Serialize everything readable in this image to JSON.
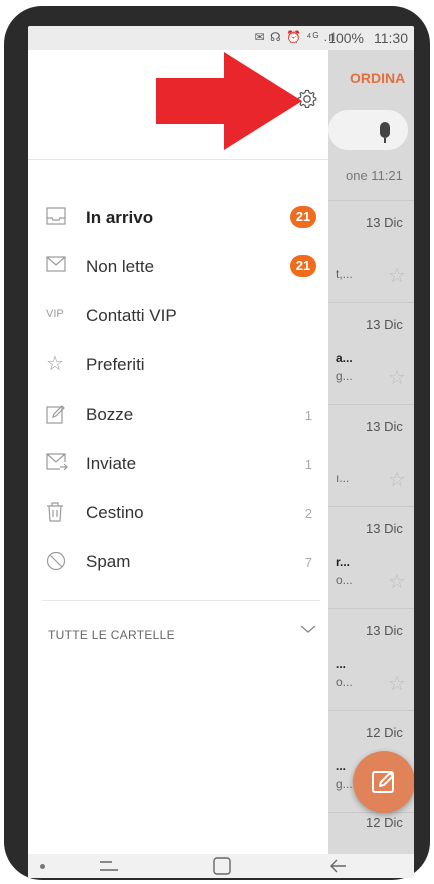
{
  "status_bar": {
    "battery": "100%",
    "time": "11:30",
    "icons": "✉ ☊ ⏰ ⁴ᴳ .ıl"
  },
  "header": {
    "sort_label": "ORDINA"
  },
  "list_preview": {
    "top_meta": "one 11:21",
    "rows": [
      {
        "date": "13 Dic",
        "line1": "",
        "line2": "t,..."
      },
      {
        "date": "13 Dic",
        "line1": "a...",
        "line2": "g..."
      },
      {
        "date": "13 Dic",
        "line1": "",
        "line2": "ı..."
      },
      {
        "date": "13 Dic",
        "line1": "r...",
        "line2": "o..."
      },
      {
        "date": "13 Dic",
        "line1": "...",
        "line2": "o..."
      },
      {
        "date": "12 Dic",
        "line1": "...",
        "line2": "g..."
      },
      {
        "date": "12 Dic",
        "line1": "",
        "line2": ""
      }
    ]
  },
  "drawer": {
    "items": [
      {
        "label": "In arrivo",
        "badge": "21",
        "icon": "inbox-icon"
      },
      {
        "label": "Non lette",
        "badge": "21",
        "icon": "envelope-icon"
      },
      {
        "label": "Contatti VIP",
        "icon_text": "VIP",
        "icon": "vip-icon"
      },
      {
        "label": "Preferiti",
        "icon": "star-icon"
      },
      {
        "label": "Bozze",
        "count": "1",
        "icon": "draft-icon"
      },
      {
        "label": "Inviate",
        "count": "1",
        "icon": "sent-icon"
      },
      {
        "label": "Cestino",
        "count": "2",
        "icon": "trash-icon"
      },
      {
        "label": "Spam",
        "count": "7",
        "icon": "block-icon"
      }
    ],
    "all_folders_label": "TUTTE LE CARTELLE"
  },
  "colors": {
    "accent": "#e0703e",
    "badge": "#ef6c1f",
    "arrow": "#e8262b"
  }
}
